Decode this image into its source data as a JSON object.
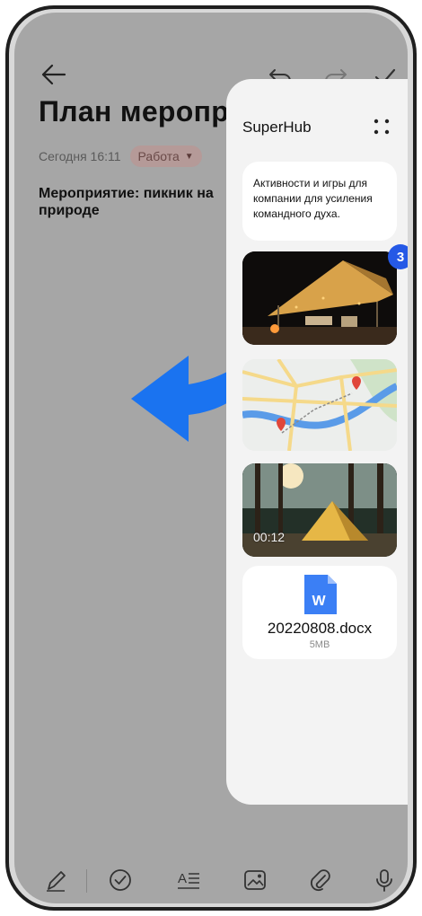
{
  "note": {
    "title": "План меропр",
    "date": "Сегодня 16:11",
    "tag": "Работа",
    "text": "Мероприятие: пикник на природе"
  },
  "superhub": {
    "title": "SuperHub",
    "text_card": "Активности и игры для компании для усиления командного духа.",
    "badge_count": "3",
    "video_duration": "00:12",
    "file": {
      "name": "20220808.docx",
      "size": "5MB",
      "icon_label": "W"
    }
  },
  "toolbar": {
    "icons": [
      "handwriting-pen-icon",
      "checklist-icon",
      "text-format-icon",
      "image-icon",
      "attachment-icon",
      "microphone-icon"
    ]
  },
  "colors": {
    "accent_blue": "#1a73f0",
    "badge_blue": "#2559e6",
    "doc_blue": "#3b7ff5",
    "screen_dim": "#a6a6a6",
    "panel_bg": "#f3f3f3"
  }
}
